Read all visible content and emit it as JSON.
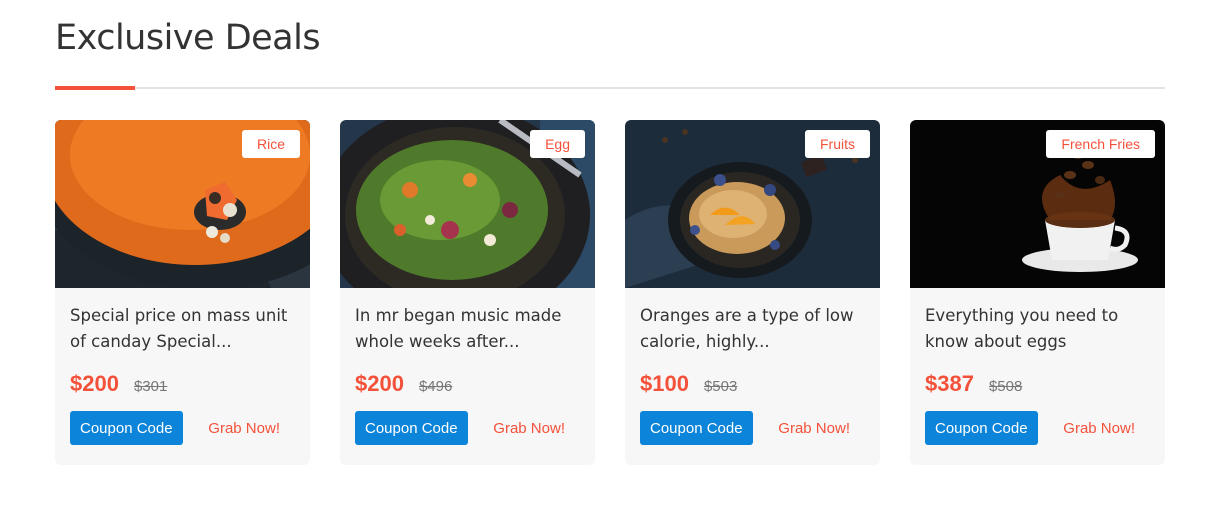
{
  "section": {
    "title": "Exclusive Deals"
  },
  "colors": {
    "accent": "#f4513a",
    "button": "#0b84d9",
    "card_bg": "#f7f7f7"
  },
  "deals": [
    {
      "tag": "Rice",
      "title": "Special price on mass unit of canday Special...",
      "price": "$200",
      "old_price": "$301",
      "coupon_label": "Coupon Code",
      "grab_label": "Grab Now!",
      "image": "soup-bowl"
    },
    {
      "tag": "Egg",
      "title": "In mr began music made whole weeks after...",
      "price": "$200",
      "old_price": "$496",
      "coupon_label": "Coupon Code",
      "grab_label": "Grab Now!",
      "image": "salad-bowl"
    },
    {
      "tag": "Fruits",
      "title": "Oranges are a type of low calorie, highly...",
      "price": "$100",
      "old_price": "$503",
      "coupon_label": "Coupon Code",
      "grab_label": "Grab Now!",
      "image": "pancake-pan"
    },
    {
      "tag": "French Fries",
      "title": "Everything you need to know about eggs",
      "price": "$387",
      "old_price": "$508",
      "coupon_label": "Coupon Code",
      "grab_label": "Grab Now!",
      "image": "coffee-cup"
    }
  ]
}
